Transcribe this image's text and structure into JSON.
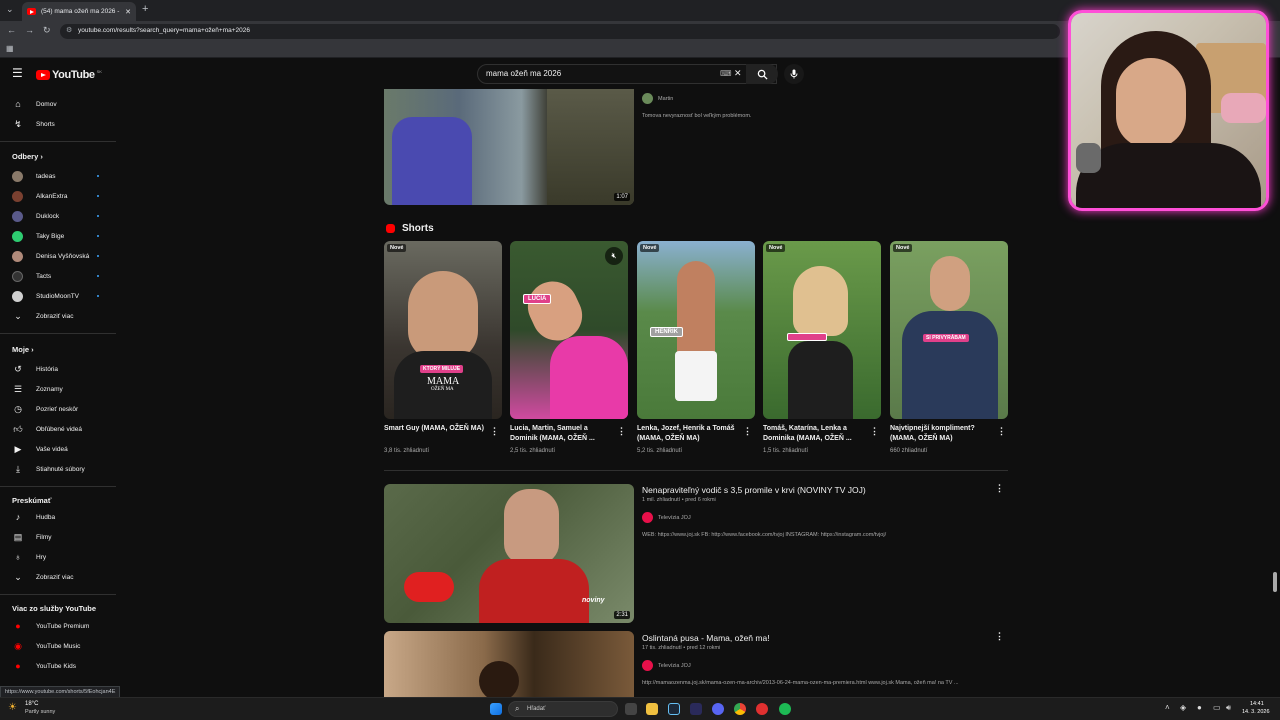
{
  "browser": {
    "tab_title": "(54) mama ožeň ma 2026 - You",
    "url": "youtube.com/results?search_query=mama+ožeň+ma+2026",
    "status_url": "https://www.youtube.com/shorts/5fEohcjan4E"
  },
  "masthead": {
    "logo_text": "YouTube",
    "logo_region": "SK",
    "search_value": "mama ožeň ma 2026"
  },
  "sidebar": {
    "top": [
      {
        "label": "Domov",
        "icon": "home-icon"
      },
      {
        "label": "Shorts",
        "icon": "shorts-icon"
      }
    ],
    "subscriptions_heading": "Odbery",
    "subscriptions": [
      {
        "label": "tadeas",
        "color": "#8a7a6a"
      },
      {
        "label": "AlkanExtra",
        "color": "#7a4030"
      },
      {
        "label": "Duklock",
        "color": "#5a5a8a"
      },
      {
        "label": "Taky Bige",
        "color": "#2ecc71"
      },
      {
        "label": "Denisa Vyšňovská",
        "color": "#b08a7a"
      },
      {
        "label": "Tacts",
        "color": "#333333"
      },
      {
        "label": "StudioMoonTV",
        "color": "#d0d0d0"
      }
    ],
    "show_more": "Zobraziť viac",
    "you_heading": "Moje",
    "you_items": [
      {
        "label": "História",
        "icon": "history-icon"
      },
      {
        "label": "Zoznamy",
        "icon": "playlists-icon"
      },
      {
        "label": "Pozrieť neskôr",
        "icon": "clock-icon"
      },
      {
        "label": "Obľúbené videá",
        "icon": "thumb-up-icon"
      },
      {
        "label": "Vaše videá",
        "icon": "your-videos-icon"
      },
      {
        "label": "Stiahnuté súbory",
        "icon": "download-icon"
      }
    ],
    "explore_heading": "Preskúmať",
    "explore_items": [
      {
        "label": "Hudba",
        "icon": "music-icon"
      },
      {
        "label": "Filmy",
        "icon": "film-icon"
      },
      {
        "label": "Hry",
        "icon": "gamepad-icon"
      },
      {
        "label": "Zobraziť viac",
        "icon": "chevron-down-icon"
      }
    ],
    "more_heading": "Viac zo služby YouTube",
    "more_items": [
      {
        "label": "YouTube Premium"
      },
      {
        "label": "YouTube Music"
      },
      {
        "label": "YouTube Kids"
      }
    ]
  },
  "top_video": {
    "channel": "Martin",
    "description": "Tomova nevyraznosť bol veľkým problémom.",
    "duration": "1:07"
  },
  "shorts": {
    "heading": "Shorts",
    "items": [
      {
        "badge": "Nové",
        "title": "Smart Guy (MAMA, OŽEŇ MA)",
        "views": "3,8 tis. zhliadnutí",
        "overlay": "KTORÝ MILUJE",
        "overlay2": "MAMA",
        "overlay3": "OŽEŇ MA",
        "bg": "#3a3530"
      },
      {
        "badge": "",
        "title": "Lucia, Martin, Samuel a Dominik (MAMA, OŽEŇ ...",
        "views": "2,5 tis. zhliadnutí",
        "overlay": "LUCIA",
        "overlay2": "",
        "overlay3": "",
        "bg": "#2f4a2a"
      },
      {
        "badge": "Nové",
        "title": "Lenka, Jozef, Henrik a Tomáš (MAMA, OŽEŇ MA)",
        "views": "5,2 tis. zhliadnutí",
        "overlay": "HENRIK",
        "overlay2": "",
        "overlay3": "",
        "bg": "#4a7a3a"
      },
      {
        "badge": "Nové",
        "title": "Tomáš, Katarína, Lenka a Dominika (MAMA, OŽEŇ ...",
        "views": "1,5 tis. zhliadnutí",
        "overlay": "",
        "overlay2": "",
        "overlay3": "",
        "bg": "#3a6a2e"
      },
      {
        "badge": "Nové",
        "title": "Najvtipnejší kompliment? (MAMA, OŽEŇ MA)",
        "views": "660 zhliadnutí",
        "overlay": "SI PRIVYRÁBAM",
        "overlay2": "",
        "overlay3": "",
        "bg": "#5a7a4a"
      }
    ]
  },
  "videos": [
    {
      "title": "Nenapraviteľný vodič s 3,5 promile v krvi (NOVINY TV JOJ)",
      "meta": "1 mil. zhliadnutí • pred 6 rokmi",
      "channel": "Televízia JOJ",
      "description": "WEB: https://www.joj.sk FB: http://www.facebook.com/tvjoj INSTAGRAM: https://instagram.com/tvjoj/",
      "duration": "2:31",
      "watermark": "noviny"
    },
    {
      "title": "Oslintaná pusa - Mama, ožeň ma!",
      "meta": "17 tis. zhliadnutí • pred 12 rokmi",
      "channel": "Televízia JOJ",
      "description": "http://mamaozenma.joj.sk/mama-ozen-ma-archiv/2013-06-24-mama-ozen-ma-premiera.html www.joj.sk Mama, ožeň ma! na TV ..."
    }
  ],
  "taskbar": {
    "weather_temp": "18°C",
    "weather_desc": "Partly sunny",
    "search_placeholder": "Hľadať",
    "time": "14:41",
    "date": "14. 3. 2026"
  },
  "colors": {
    "accent_red": "#ff0000",
    "webcam_border": "#ff4fd8",
    "link_blue": "#3ea6ff"
  }
}
